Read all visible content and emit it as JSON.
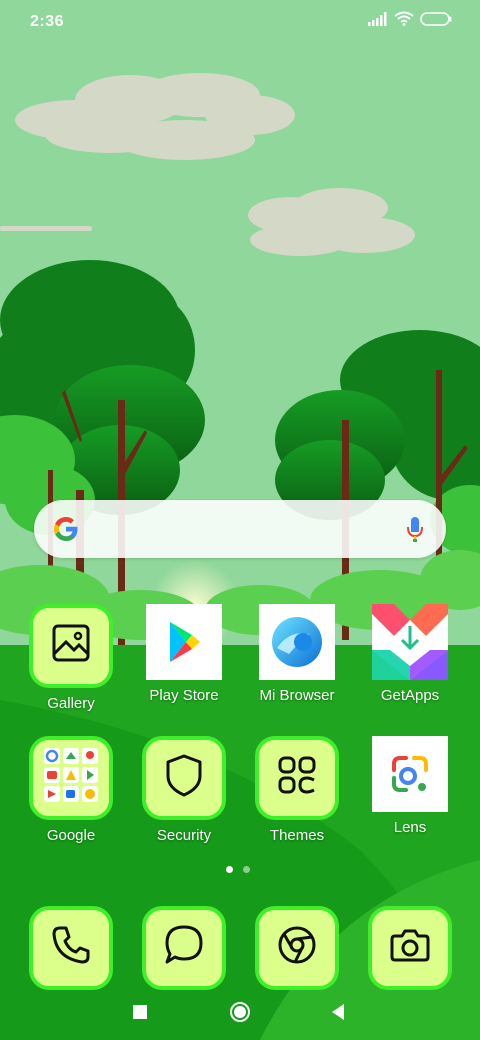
{
  "status_bar": {
    "time": "2:36",
    "icons": [
      "signal-icon",
      "wifi-icon",
      "battery-icon"
    ]
  },
  "search_bar": {
    "icons": [
      "google-g-icon",
      "microphone-icon"
    ]
  },
  "apps_row1": [
    {
      "label": "Gallery",
      "icon": "gallery-icon"
    },
    {
      "label": "Play Store",
      "icon": "play-store-icon"
    },
    {
      "label": "Mi Browser",
      "icon": "mi-browser-icon"
    },
    {
      "label": "GetApps",
      "icon": "getapps-icon"
    }
  ],
  "apps_row2": [
    {
      "label": "Google",
      "icon": "google-folder-icon"
    },
    {
      "label": "Security",
      "icon": "shield-icon"
    },
    {
      "label": "Themes",
      "icon": "themes-icon"
    },
    {
      "label": "Lens",
      "icon": "lens-icon"
    }
  ],
  "dock": [
    {
      "icon": "phone-icon"
    },
    {
      "icon": "message-icon"
    },
    {
      "icon": "chrome-icon"
    },
    {
      "icon": "camera-icon"
    }
  ],
  "page_indicator": {
    "pages": 2,
    "current": 1
  },
  "nav_bar": {
    "icons": [
      "recents-icon",
      "home-icon",
      "back-icon"
    ]
  },
  "colors": {
    "sky": "#8fd79a",
    "grass": "#1fa51f",
    "icon_lime": "#dcff8c",
    "icon_border": "#3ef02a"
  }
}
